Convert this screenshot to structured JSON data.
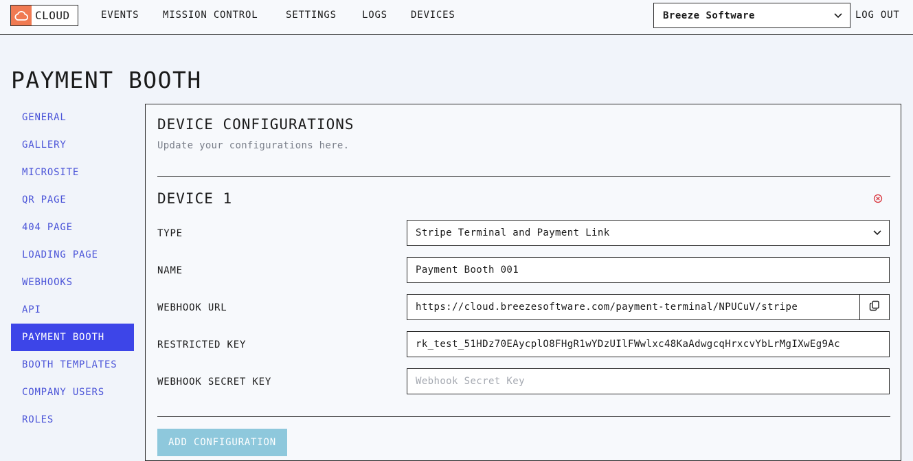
{
  "header": {
    "logo_text": "CLOUD",
    "logo_icon": "cloud-icon",
    "brand_color": "#f07a52",
    "nav": [
      "EVENTS",
      "MISSION CONTROL",
      "SETTINGS",
      "LOGS",
      "DEVICES"
    ],
    "company_selected": "Breeze Software",
    "logout_label": "LOG OUT"
  },
  "page_title": "PAYMENT BOOTH",
  "sidebar": {
    "accent_color": "#3d45e8",
    "active_index": 8,
    "items": [
      {
        "label": "GENERAL"
      },
      {
        "label": "GALLERY"
      },
      {
        "label": "MICROSITE"
      },
      {
        "label": "QR PAGE"
      },
      {
        "label": "404 PAGE"
      },
      {
        "label": "LOADING PAGE"
      },
      {
        "label": "WEBHOOKS"
      },
      {
        "label": "API"
      },
      {
        "label": "PAYMENT BOOTH"
      },
      {
        "label": "BOOTH TEMPLATES"
      },
      {
        "label": "COMPANY USERS"
      },
      {
        "label": "ROLES"
      }
    ]
  },
  "card": {
    "title": "DEVICE CONFIGURATIONS",
    "subtitle": "Update your configurations here.",
    "device": {
      "title": "DEVICE 1",
      "remove_icon": "remove-circle-icon",
      "fields": {
        "type": {
          "label": "TYPE",
          "value": "Stripe Terminal and Payment Link"
        },
        "name": {
          "label": "NAME",
          "value": "Payment Booth 001"
        },
        "webhook_url": {
          "label": "WEBHOOK URL",
          "value": "https://cloud.breezesoftware.com/payment-terminal/NPUCuV/stripe",
          "copy_icon": "copy-icon"
        },
        "restricted_key": {
          "label": "RESTRICTED KEY",
          "value": "rk_test_51HDz70EAycplO8FHgR1wYDzUIlFWwlxc48KaAdwgcqHrxcvYbLrMgIXwEg9Ac"
        },
        "webhook_secret": {
          "label": "WEBHOOK SECRET KEY",
          "value": "",
          "placeholder": "Webhook Secret Key"
        }
      }
    },
    "add_button_label": "ADD CONFIGURATION"
  }
}
